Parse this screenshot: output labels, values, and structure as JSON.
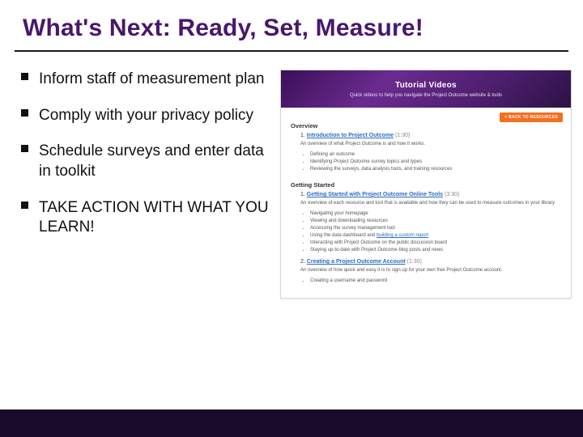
{
  "title": "What's Next: Ready, Set, Measure!",
  "bullets": [
    "Inform staff of measurement plan",
    "Comply with your privacy policy",
    "Schedule surveys  and enter data in toolkit",
    "TAKE ACTION WITH WHAT YOU LEARN!"
  ],
  "thumb": {
    "banner_title": "Tutorial Videos",
    "banner_sub": "Quick videos to help you navigate the Project Outcome website & tools",
    "back_btn": "< BACK TO RESOURCES",
    "overview_h": "Overview",
    "item1_num": "1.",
    "item1_link": "Introduction to Project Outcome",
    "item1_dur": "(1:30)",
    "item1_para": "An overview of what Project Outcome is and how it works.",
    "item1_b1": "Defining an outcome",
    "item1_b2": "Identifying Project Outcome survey topics and types",
    "item1_b3": "Reviewing the surveys, data analysis tools, and training resources",
    "getting_h": "Getting Started",
    "item2_num": "1.",
    "item2_link": "Getting Started with Project Outcome Online Tools",
    "item2_dur": "(3:30)",
    "item2_para": "An overview of each resource and tool that is available and how they can be used to measure outcomes in your library.",
    "item2_b1": "Navigating your homepage",
    "item2_b2": "Viewing and downloading resources",
    "item2_b3": "Accessing the survey management tool",
    "item2_b4a": "Using the data dashboard and ",
    "item2_b4b": "building a custom report",
    "item2_b5": "Interacting with Project Outcome on the public discussion board",
    "item2_b6": "Staying up-to-date with Project Outcome blog posts and news",
    "item3_num": "2.",
    "item3_link": "Creating a Project Outcome Account",
    "item3_dur": "(1:30)",
    "item3_para": "An overview of how quick and easy it is to sign up for your own free Project Outcome account.",
    "item3_b1": "Creating a username and password"
  }
}
